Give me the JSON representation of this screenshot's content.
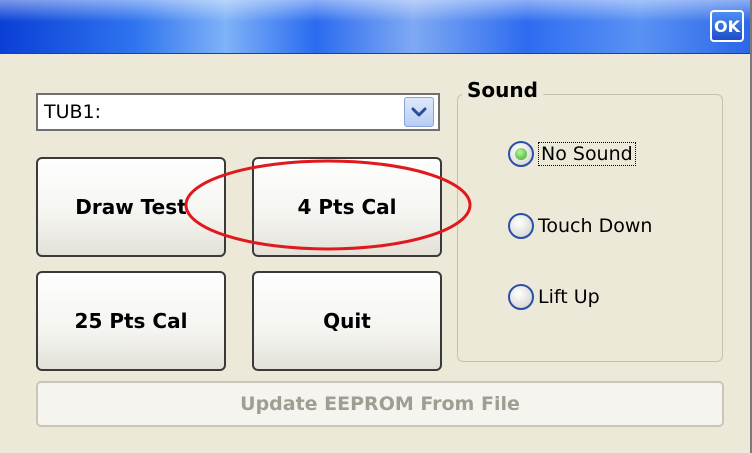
{
  "titlebar": {
    "ok_label": "OK"
  },
  "port_select": {
    "value": "TUB1:"
  },
  "buttons": {
    "draw_test": "Draw Test",
    "four_pts_cal": "4 Pts Cal",
    "twentyfive_pts_cal": "25 Pts Cal",
    "quit": "Quit",
    "update_eeprom": "Update EEPROM From File"
  },
  "sound": {
    "title": "Sound",
    "options": [
      {
        "label": "No Sound",
        "selected": true
      },
      {
        "label": "Touch Down",
        "selected": false
      },
      {
        "label": "Lift Up",
        "selected": false
      }
    ]
  },
  "colors": {
    "annotation": "#e0191f",
    "selected_radio": "#3aa81f",
    "title_bar": "#2f74ef"
  }
}
